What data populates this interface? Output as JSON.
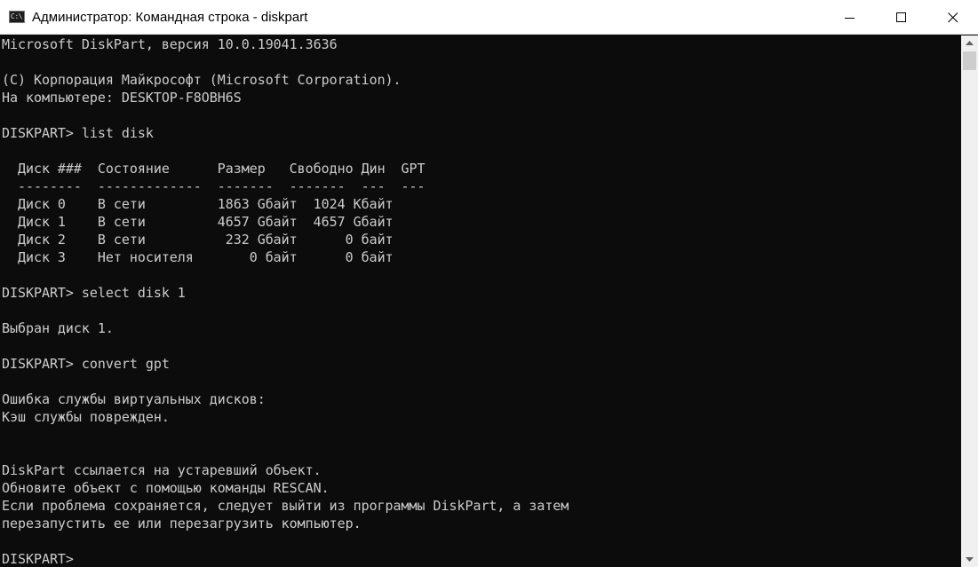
{
  "window": {
    "title": "Администратор: Командная строка - diskpart",
    "icon_text": "C:\\"
  },
  "console": {
    "lines": [
      "Microsoft DiskPart, версия 10.0.19041.3636",
      "",
      "(C) Корпорация Майкрософт (Microsoft Corporation).",
      "На компьютере: DESKTOP-F8OBH6S",
      "",
      "DISKPART> list disk",
      "",
      "  Диск ###  Состояние      Размер   Свободно Дин  GPT",
      "  --------  -------------  -------  -------  ---  ---",
      "  Диск 0    В сети         1863 Gбайт  1024 Kбайт",
      "  Диск 1    В сети         4657 Gбайт  4657 Gбайт",
      "  Диск 2    В сети          232 Gбайт      0 байт",
      "  Диск 3    Нет носителя       0 байт      0 байт",
      "",
      "DISKPART> select disk 1",
      "",
      "Выбран диск 1.",
      "",
      "DISKPART> convert gpt",
      "",
      "Ошибка службы виртуальных дисков:",
      "Кэш службы поврежден.",
      "",
      "",
      "DiskPart ссылается на устаревший объект.",
      "Обновите объект с помощью команды RESCAN.",
      "Если проблема сохраняется, следует выйти из программы DiskPart, а затем",
      "перезапустить ее или перезагрузить компьютер.",
      "",
      "DISKPART> "
    ]
  },
  "controls": {
    "minimize_icon": "minimize-icon",
    "maximize_icon": "maximize-icon",
    "close_icon": "close-icon"
  },
  "colors": {
    "console_bg": "#0c0c0c",
    "console_fg": "#cccccc",
    "titlebar_bg": "#ffffff"
  }
}
